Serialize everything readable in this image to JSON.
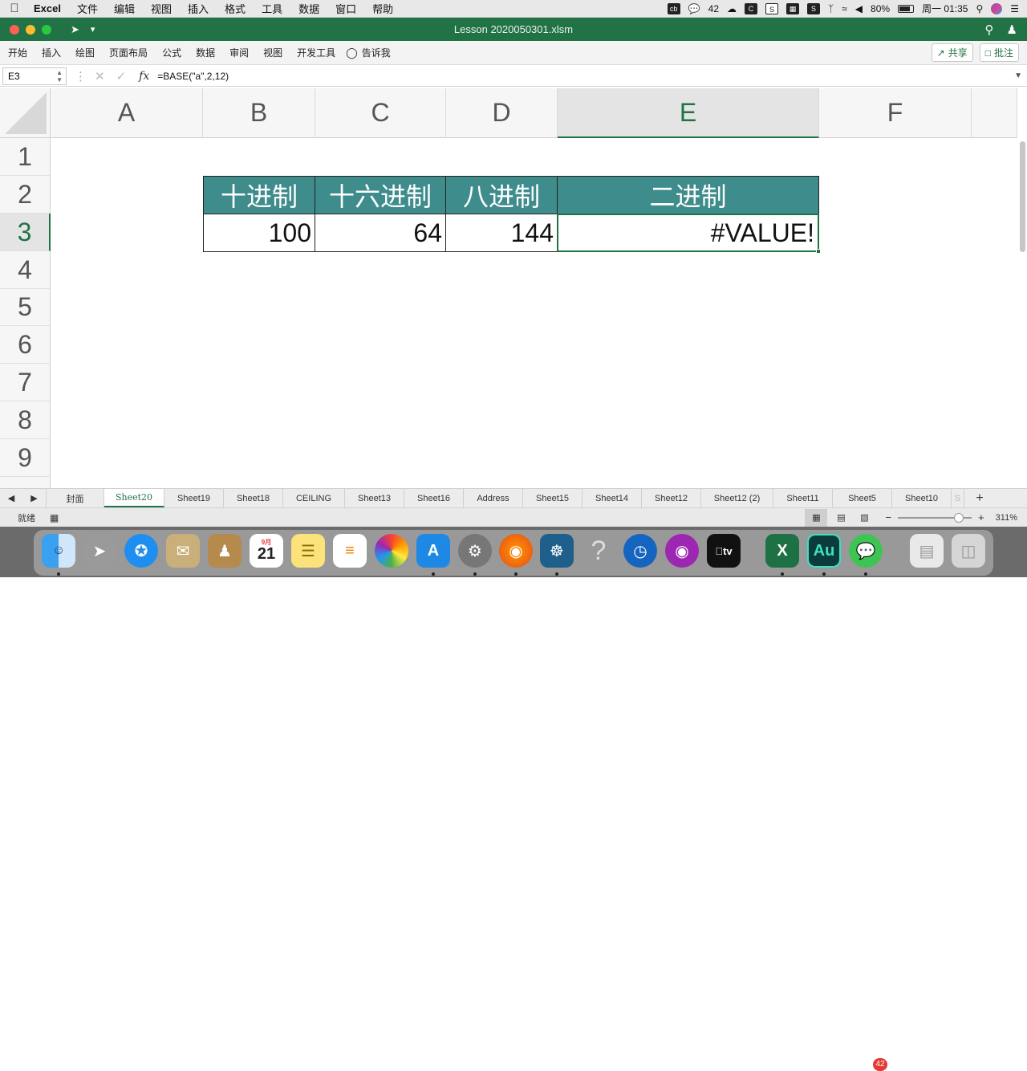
{
  "menubar": {
    "app_name": "Excel",
    "items": [
      "文件",
      "编辑",
      "视图",
      "插入",
      "格式",
      "工具",
      "数据",
      "窗口",
      "帮助"
    ],
    "wechat_count": "42",
    "battery": "80%",
    "clock": "周一 01:35"
  },
  "window": {
    "title": "Lesson 2020050301.xlsm"
  },
  "ribbon": {
    "tabs": [
      "开始",
      "插入",
      "绘图",
      "页面布局",
      "公式",
      "数据",
      "审阅",
      "视图",
      "开发工具"
    ],
    "tell_me": "告诉我",
    "share_label": "共享",
    "comments_label": "批注"
  },
  "formula_bar": {
    "name_box": "E3",
    "fx_label": "fx",
    "formula": "=BASE(\"a\",2,12)"
  },
  "grid": {
    "columns": [
      "A",
      "B",
      "C",
      "D",
      "E",
      "F"
    ],
    "selected_column": "E",
    "rows": [
      "1",
      "2",
      "3",
      "4",
      "5",
      "6",
      "7",
      "8",
      "9"
    ],
    "selected_row": "3",
    "headers": [
      "十进制",
      "十六进制",
      "八进制",
      "二进制"
    ],
    "values": [
      "100",
      "64",
      "144",
      "#VALUE!"
    ],
    "header_color": "#3f8c8c",
    "accent_color": "#217346"
  },
  "sheet_tabs": [
    "封面",
    "Sheet20",
    "Sheet19",
    "Sheet18",
    "CEILING",
    "Sheet13",
    "Sheet16",
    "Address",
    "Sheet15",
    "Sheet14",
    "Sheet12",
    "Sheet12 (2)",
    "Sheet11",
    "Sheet5",
    "Sheet10"
  ],
  "active_sheet": "Sheet20",
  "status_bar": {
    "ready": "就绪",
    "zoom": "311%"
  },
  "dock": {
    "wechat_badge": "42",
    "calendar_month": "9月",
    "calendar_day": "21"
  }
}
